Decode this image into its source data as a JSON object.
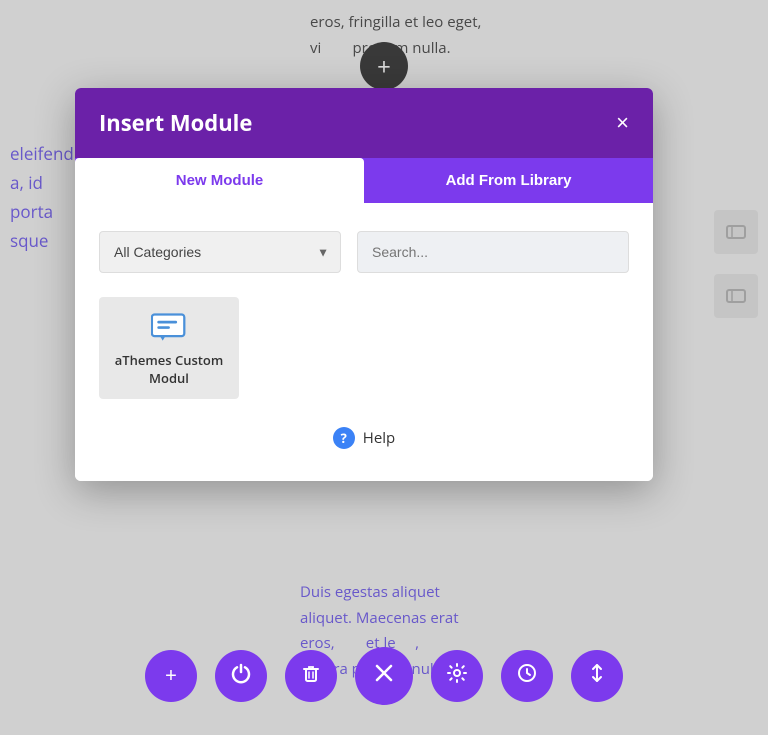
{
  "background": {
    "left_text_lines": [
      "eleifend",
      "a, id",
      "porta",
      "",
      "sque"
    ],
    "top_text_lines": [
      "eros, fringilla et leo eget,",
      "vi         pretium nulla."
    ],
    "bottom_text_lines": [
      "Duis egestas aliquet",
      "aliquet. Maecenas erat",
      "eros,          et le     ,",
      "viverra pretium nulla."
    ]
  },
  "top_plus_button": {
    "label": "+"
  },
  "modal": {
    "title": "Insert Module",
    "close_label": "×",
    "tabs": [
      {
        "label": "New Module",
        "active": true
      },
      {
        "label": "Add From Library",
        "active": false
      }
    ],
    "filter": {
      "category_label": "All Categories",
      "search_placeholder": "Search..."
    },
    "modules": [
      {
        "name": "aThemes Custom Modul",
        "icon_type": "chat"
      }
    ],
    "help": {
      "label": "Help"
    }
  },
  "toolbar": {
    "buttons": [
      {
        "icon": "+",
        "name": "add-button"
      },
      {
        "icon": "⏻",
        "name": "power-button"
      },
      {
        "icon": "🗑",
        "name": "delete-button"
      },
      {
        "icon": "×",
        "name": "close-button",
        "is_center": true
      },
      {
        "icon": "⚙",
        "name": "settings-button"
      },
      {
        "icon": "🕐",
        "name": "history-button"
      },
      {
        "icon": "⇅",
        "name": "sort-button"
      }
    ]
  }
}
